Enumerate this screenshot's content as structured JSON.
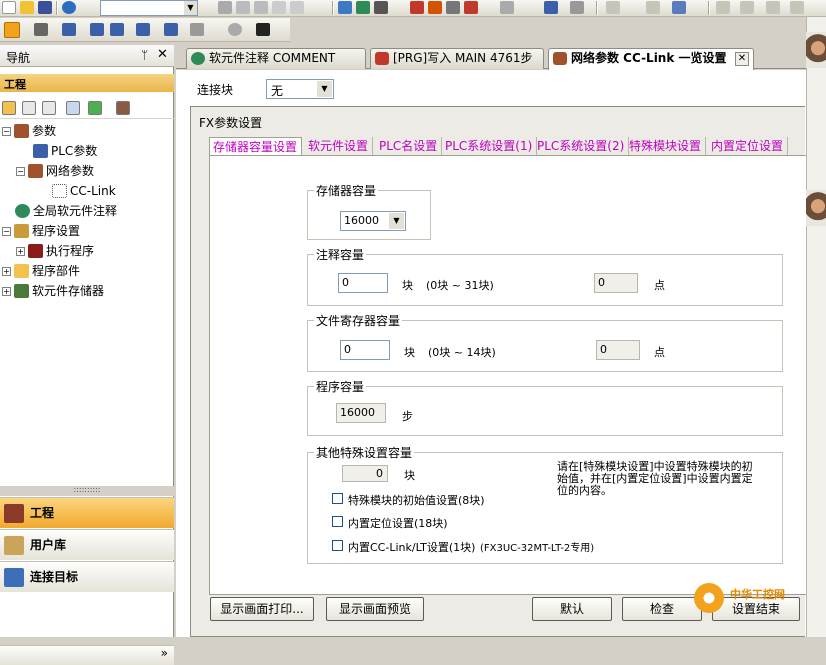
{
  "nav": {
    "title": "导航",
    "pin": "ᛘ",
    "close": "✕",
    "project_header": "工程",
    "tree": [
      {
        "label": "参数",
        "level": 0,
        "expander": "−"
      },
      {
        "label": "PLC参数",
        "level": 1,
        "expander": ""
      },
      {
        "label": "网络参数",
        "level": 1,
        "expander": "−"
      },
      {
        "label": "CC-Link",
        "level": 2,
        "expander": ""
      },
      {
        "label": "全局软元件注释",
        "level": 0,
        "expander": ""
      },
      {
        "label": "程序设置",
        "level": 0,
        "expander": "−"
      },
      {
        "label": "执行程序",
        "level": 1,
        "expander": "+"
      },
      {
        "label": "程序部件",
        "level": 0,
        "expander": "+"
      },
      {
        "label": "软元件存储器",
        "level": 0,
        "expander": "+"
      }
    ],
    "splitter": "::::::::::",
    "buttons": [
      {
        "label": "工程",
        "active": true
      },
      {
        "label": "用户库",
        "active": false
      },
      {
        "label": "连接目标",
        "active": false
      }
    ],
    "more": "»"
  },
  "tabs": [
    {
      "label": "软元件注释 COMMENT",
      "icon": "comment-icon",
      "active": false
    },
    {
      "label": "[PRG]写入 MAIN 4761步",
      "icon": "program-icon",
      "active": false
    },
    {
      "label": "网络参数  CC-Link 一览设置",
      "icon": "network-icon",
      "active": true
    }
  ],
  "tab_close": "✕",
  "content": {
    "link_label": "连接块",
    "link_value": "无"
  },
  "dialog": {
    "title": "FX参数设置",
    "tabs": [
      "存储器容量设置",
      "软元件设置",
      "PLC名设置",
      "PLC系统设置(1)",
      "PLC系统设置(2)",
      "特殊模块设置",
      "内置定位设置"
    ],
    "memory": {
      "title": "存储器容量",
      "value": "16000"
    },
    "comment": {
      "title": "注释容量",
      "value": "0",
      "unit": "块",
      "range": "(0块 ~ 31块)",
      "points": "0",
      "points_unit": "点"
    },
    "file_reg": {
      "title": "文件寄存器容量",
      "value": "0",
      "unit": "块",
      "range": "(0块 ~ 14块)",
      "points": "0",
      "points_unit": "点"
    },
    "program": {
      "title": "程序容量",
      "value": "16000",
      "unit": "步"
    },
    "other": {
      "title": "其他特殊设置容量",
      "value": "0",
      "unit": "块",
      "note": "请在[特殊模块设置]中设置特殊模块的初始值，并在[内置定位设置]中设置内置定位的内容。",
      "checks": [
        {
          "label": "特殊模块的初始值设置(8块)",
          "checked": false
        },
        {
          "label": "内置定位设置(18块)",
          "checked": false
        },
        {
          "label": "内置CC-Link/LT设置(1块)",
          "checked": false
        }
      ],
      "check3_suffix": "(FX3UC-32MT-LT-2专用)"
    },
    "buttons": {
      "print": "显示画面打印...",
      "preview": "显示画面预览",
      "default": "默认",
      "check": "检查",
      "finish": "设置结束"
    }
  },
  "watermark": "中华工控网"
}
